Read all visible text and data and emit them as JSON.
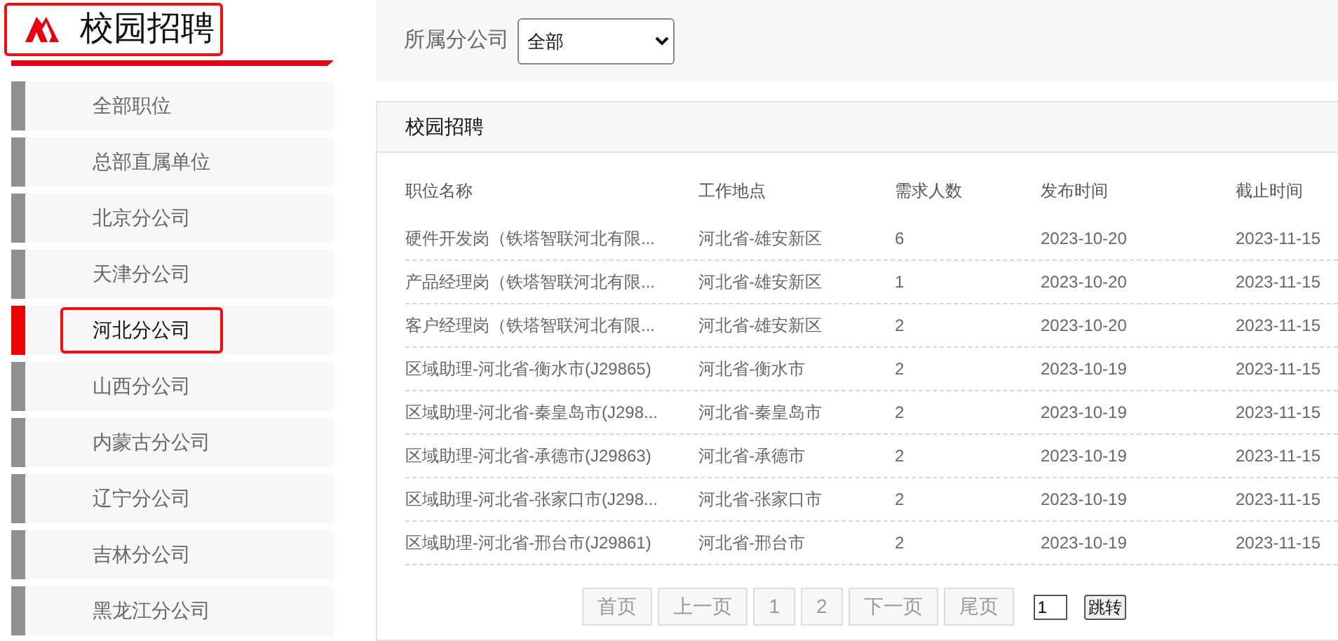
{
  "header": {
    "title": "校园招聘",
    "highlighted": true
  },
  "sidebar": {
    "items": [
      {
        "label": "全部职位",
        "selected": false,
        "highlighted": false
      },
      {
        "label": "总部直属单位",
        "selected": false,
        "highlighted": false
      },
      {
        "label": "北京分公司",
        "selected": false,
        "highlighted": false
      },
      {
        "label": "天津分公司",
        "selected": false,
        "highlighted": false
      },
      {
        "label": "河北分公司",
        "selected": true,
        "highlighted": true
      },
      {
        "label": "山西分公司",
        "selected": false,
        "highlighted": false
      },
      {
        "label": "内蒙古分公司",
        "selected": false,
        "highlighted": false
      },
      {
        "label": "辽宁分公司",
        "selected": false,
        "highlighted": false
      },
      {
        "label": "吉林分公司",
        "selected": false,
        "highlighted": false
      },
      {
        "label": "黑龙江分公司",
        "selected": false,
        "highlighted": false
      }
    ]
  },
  "filter": {
    "label": "所属分公司",
    "value": "全部"
  },
  "panel": {
    "title": "校园招聘"
  },
  "table": {
    "columns": [
      "职位名称",
      "工作地点",
      "需求人数",
      "发布时间",
      "截止时间"
    ],
    "rows": [
      [
        "硬件开发岗（铁塔智联河北有限...",
        "河北省-雄安新区",
        "6",
        "2023-10-20",
        "2023-11-15"
      ],
      [
        "产品经理岗（铁塔智联河北有限...",
        "河北省-雄安新区",
        "1",
        "2023-10-20",
        "2023-11-15"
      ],
      [
        "客户经理岗（铁塔智联河北有限...",
        "河北省-雄安新区",
        "2",
        "2023-10-20",
        "2023-11-15"
      ],
      [
        "区域助理-河北省-衡水市(J29865)",
        "河北省-衡水市",
        "2",
        "2023-10-19",
        "2023-11-15"
      ],
      [
        "区域助理-河北省-秦皇岛市(J298...",
        "河北省-秦皇岛市",
        "2",
        "2023-10-19",
        "2023-11-15"
      ],
      [
        "区域助理-河北省-承德市(J29863)",
        "河北省-承德市",
        "2",
        "2023-10-19",
        "2023-11-15"
      ],
      [
        "区域助理-河北省-张家口市(J298...",
        "河北省-张家口市",
        "2",
        "2023-10-19",
        "2023-11-15"
      ],
      [
        "区域助理-河北省-邢台市(J29861)",
        "河北省-邢台市",
        "2",
        "2023-10-19",
        "2023-11-15"
      ]
    ]
  },
  "pagination": {
    "buttons": [
      "首页",
      "上一页",
      "1",
      "2",
      "下一页",
      "尾页"
    ],
    "page_input": "1",
    "go": "跳转"
  }
}
